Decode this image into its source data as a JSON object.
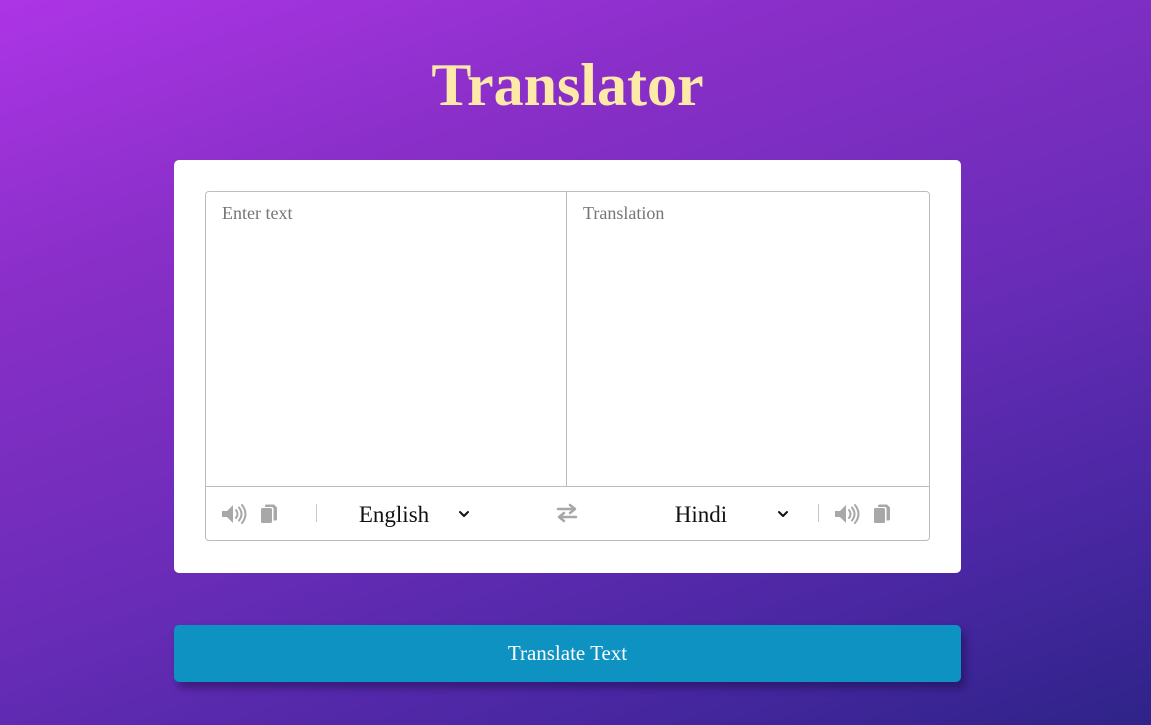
{
  "header": {
    "title": "Translator"
  },
  "from_panel": {
    "placeholder": "Enter text",
    "value": ""
  },
  "to_panel": {
    "placeholder": "Translation",
    "value": ""
  },
  "controls": {
    "from_language": {
      "selected": "English"
    },
    "to_language": {
      "selected": "Hindi"
    },
    "icons": {
      "speak": "volume-icon",
      "copy": "copy-icon",
      "swap": "exchange-icon",
      "dropdown": "chevron-down-icon"
    }
  },
  "actions": {
    "translate_label": "Translate Text"
  },
  "colors": {
    "title": "#fde9a8",
    "button": "#0d92c1",
    "icon": "#a8a8a8",
    "gradient_start": "#ad35e6",
    "gradient_end": "#2e2388"
  }
}
